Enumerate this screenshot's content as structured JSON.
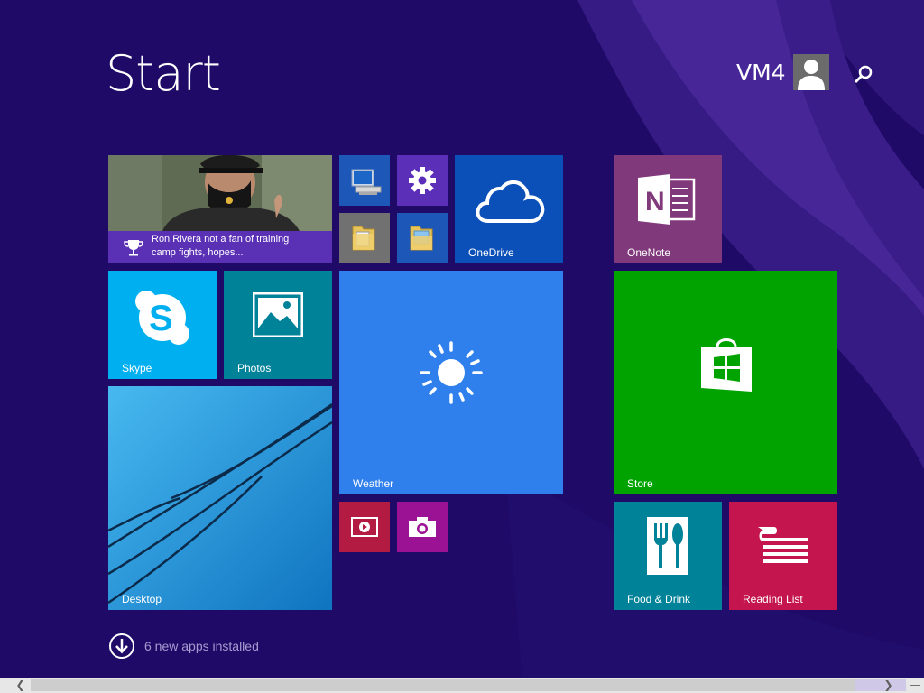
{
  "header": {
    "title": "Start",
    "user_name": "VM4"
  },
  "tiles": {
    "news": {
      "caption": "Ron Rivera not a fan of training camp fights, hopes...",
      "color": "#5a30b5"
    },
    "this_pc": {
      "color": "#1d57b8"
    },
    "pc_settings": {
      "color": "#5b2fb8"
    },
    "onedrive": {
      "label": "OneDrive",
      "color": "#0b4fb8"
    },
    "file_explorer_1": {
      "color": "#717171"
    },
    "file_explorer_2": {
      "color": "#1d57b8"
    },
    "onenote": {
      "label": "OneNote",
      "color": "#80397b"
    },
    "skype": {
      "label": "Skype",
      "color": "#00aff0"
    },
    "photos": {
      "label": "Photos",
      "color": "#008299"
    },
    "weather": {
      "label": "Weather",
      "color": "#2f80ed"
    },
    "store": {
      "label": "Store",
      "color": "#00a300"
    },
    "desktop": {
      "label": "Desktop",
      "color": "#1a8fd8"
    },
    "video": {
      "color": "#b31b43"
    },
    "camera": {
      "color": "#9b1294"
    },
    "food_drink": {
      "label": "Food & Drink",
      "color": "#008299"
    },
    "reading_list": {
      "label": "Reading List",
      "color": "#c4154e"
    }
  },
  "footer": {
    "new_apps": "6 new apps installed"
  }
}
